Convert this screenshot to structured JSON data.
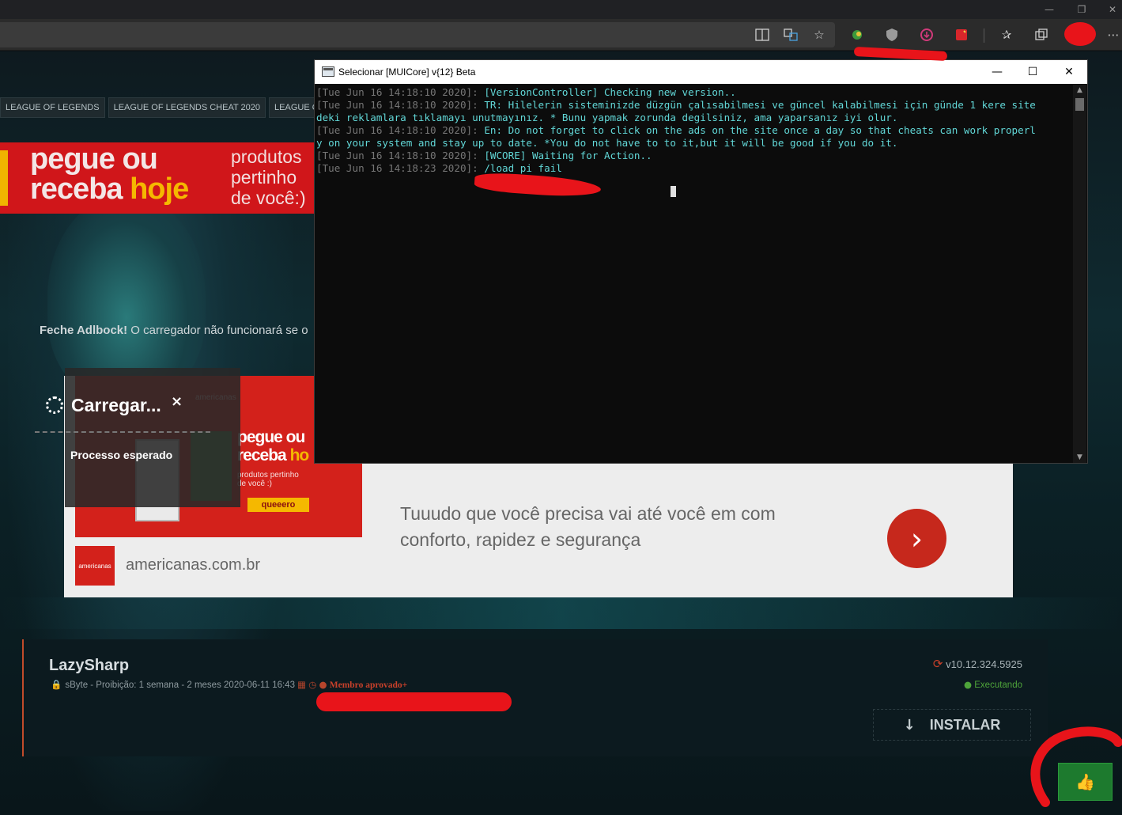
{
  "browser": {
    "window_controls": {
      "minimize": "—",
      "restore": "❐",
      "close": "✕"
    },
    "toolbar_icons": [
      "immersive-reader-icon",
      "translate-icon",
      "favorite-star-icon",
      "extension-icon",
      "ublock-shield-icon",
      "download-extension-icon",
      "extension-red-icon",
      "favorites-icon",
      "collections-icon",
      "profile-avatar-icon",
      "more-menu-icon"
    ],
    "more_label": "⋯"
  },
  "site": {
    "tags": [
      "LEAGUE OF LEGENDS",
      "LEAGUE OF LEGENDS CHEAT 2020",
      "LEAGUE OF LEGEN"
    ],
    "top_banner": {
      "line1": "pegue ou",
      "line2_a": "receba ",
      "line2_b": "hoje",
      "side": "produtos\npertinho\nde você:)"
    },
    "adblock_notice": {
      "bold": "Feche Adlbock!",
      "text": " O carregador não funcionará se o"
    },
    "ad": {
      "brand_small": "americanas",
      "headline_a": "pegue ou",
      "headline_b": "receba ",
      "headline_c": "ho",
      "subline": "produtos pertinho\nde você :)",
      "cta": "queeero",
      "description": "Tuuudo que você precisa vai até você em com conforto, rapidez e segurança",
      "logo_text": "americanas",
      "domain": "americanas.com.br",
      "next": "›"
    },
    "loader": {
      "title": "Carregar...",
      "close": "×",
      "subtitle": "Processo esperado"
    },
    "product": {
      "name": "LazySharp",
      "meta": "sByte - Proibição: 1 semana - 2 meses 2020-06-11 16:43",
      "member": "Membro aprovado+",
      "version": "v10.12.324.5925",
      "status": "Executando",
      "install_label": "INSTALAR",
      "install_icon": "↓"
    },
    "like_icon": "👍"
  },
  "console": {
    "title": "Selecionar [MUICore] v{12} Beta",
    "controls": {
      "minimize": "—",
      "maximize": "☐",
      "close": "✕"
    },
    "lines": [
      {
        "ts": "[Tue Jun 16 14:18:10 2020]: ",
        "msg": "[VersionController] Checking new version.."
      },
      {
        "ts": "[Tue Jun 16 14:18:10 2020]: ",
        "msg": "TR: Hilelerin sisteminizde düzgün çalısabilmesi ve güncel kalabilmesi için günde 1 kere site"
      },
      {
        "ts": "",
        "msg": "deki reklamlara tıklamayı unutmayınız. * Bunu yapmak zorunda degilsiniz, ama yaparsanız iyi olur."
      },
      {
        "ts": "[Tue Jun 16 14:18:10 2020]: ",
        "msg": "En: Do not forget to click on the ads on the site once a day so that cheats can work properl"
      },
      {
        "ts": "",
        "msg": "y on your system and stay up to date. *You do not have to to it,but it will be good if you do it."
      },
      {
        "ts": "[Tue Jun 16 14:18:10 2020]: ",
        "msg": "[WCORE] Waiting for Action.."
      },
      {
        "ts": "[Tue Jun 16 14:18:23 2020]: ",
        "msg": "/load pi fail"
      }
    ],
    "scroll_up": "▲",
    "scroll_down": "▼"
  },
  "colors": {
    "accent_red": "#e8141a",
    "console_cyan": "#61d6d6",
    "status_green": "#4ea43a",
    "member_red": "#c8402a"
  }
}
